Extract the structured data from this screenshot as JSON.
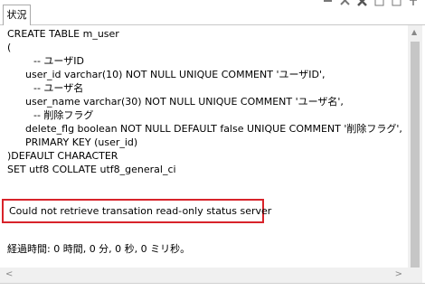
{
  "tab": {
    "label": "状況"
  },
  "toolbar": {
    "icons": [
      "minimize-icon",
      "close-all-icon",
      "remove-icon",
      "copy-icon",
      "paste-icon",
      "pin-icon"
    ]
  },
  "sql_lines": [
    "CREATE TABLE m_user",
    "(",
    "-- ユーザID",
    "user_id varchar(10) NOT NULL UNIQUE COMMENT 'ユーザID',",
    "-- ユーザ名",
    "user_name varchar(30) NOT NULL UNIQUE COMMENT 'ユーザ名',",
    "-- 削除フラグ",
    "delete_flg boolean NOT NULL DEFAULT false UNIQUE COMMENT '削除フラグ',",
    "PRIMARY KEY (user_id)",
    ")DEFAULT CHARACTER",
    "SET utf8 COLLATE utf8_general_ci"
  ],
  "error_message": "Could not retrieve transation read-only status server",
  "elapsed_time": "経過時間: 0 時間, 0 分, 0 秒, 0 ミリ秒。",
  "colors": {
    "highlight_border": "#d8232a",
    "scrollbar": "#c6c6c6"
  }
}
